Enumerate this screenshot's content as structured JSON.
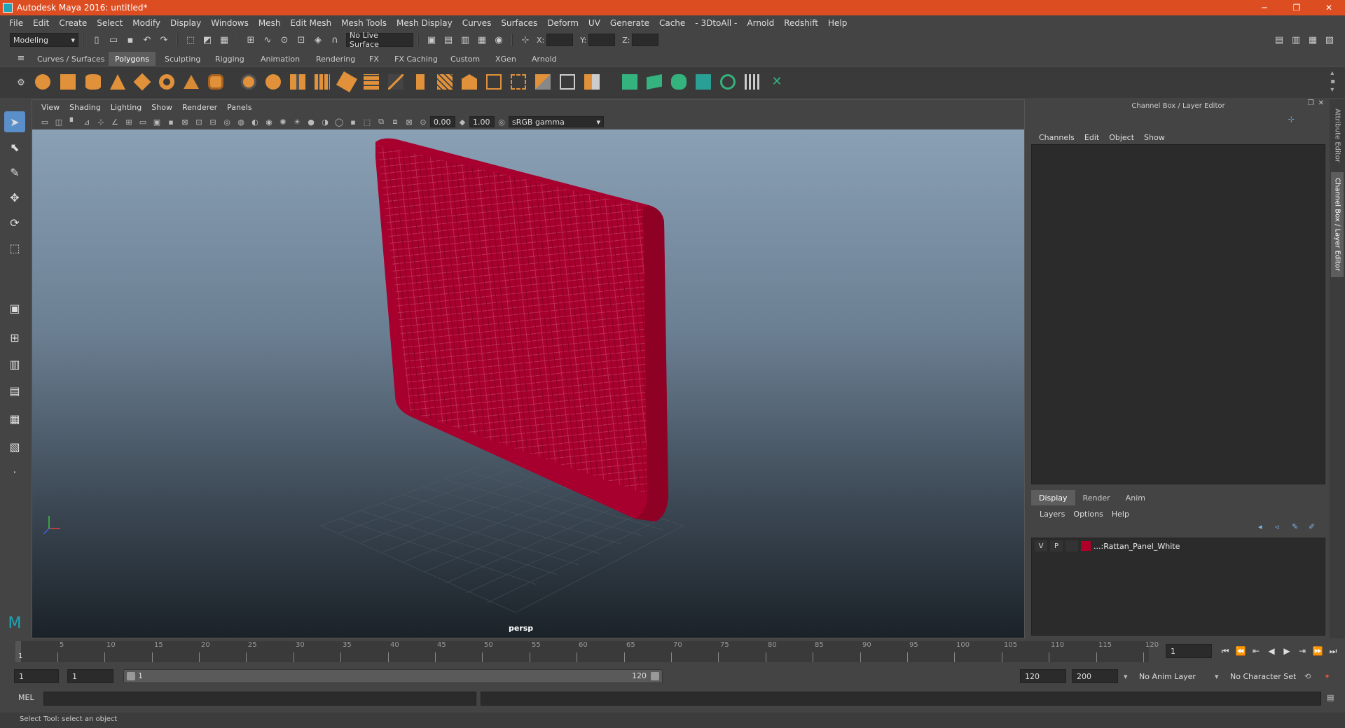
{
  "window": {
    "title": "Autodesk Maya 2016: untitled*",
    "controls": [
      "─",
      "❐",
      "✕"
    ]
  },
  "menubar": [
    "File",
    "Edit",
    "Create",
    "Select",
    "Modify",
    "Display",
    "Windows",
    "Mesh",
    "Edit Mesh",
    "Mesh Tools",
    "Mesh Display",
    "Curves",
    "Surfaces",
    "Deform",
    "UV",
    "Generate",
    "Cache",
    "- 3DtoAll -",
    "Arnold",
    "Redshift",
    "Help"
  ],
  "statusline": {
    "mode": "Modeling",
    "live_surface": "No Live Surface",
    "x_label": "X:",
    "y_label": "Y:",
    "z_label": "Z:"
  },
  "shelf_tabs": [
    {
      "label": "Curves / Surfaces",
      "active": false
    },
    {
      "label": "Polygons",
      "active": true
    },
    {
      "label": "Sculpting",
      "active": false
    },
    {
      "label": "Rigging",
      "active": false
    },
    {
      "label": "Animation",
      "active": false
    },
    {
      "label": "Rendering",
      "active": false
    },
    {
      "label": "FX",
      "active": false
    },
    {
      "label": "FX Caching",
      "active": false
    },
    {
      "label": "Custom",
      "active": false
    },
    {
      "label": "XGen",
      "active": false
    },
    {
      "label": "Arnold",
      "active": false
    }
  ],
  "viewport": {
    "menu": [
      "View",
      "Shading",
      "Lighting",
      "Show",
      "Renderer",
      "Panels"
    ],
    "exposure": "0.00",
    "gamma": "1.00",
    "color_space": "sRGB gamma",
    "camera": "persp"
  },
  "channel_box": {
    "header": "Channel Box / Layer Editor",
    "menu": [
      "Channels",
      "Edit",
      "Object",
      "Show"
    ]
  },
  "layer_editor": {
    "tabs": [
      {
        "label": "Display",
        "active": true
      },
      {
        "label": "Render",
        "active": false
      },
      {
        "label": "Anim",
        "active": false
      }
    ],
    "menu": [
      "Layers",
      "Options",
      "Help"
    ],
    "layers": [
      {
        "v": "V",
        "p": "P",
        "color": "#b0002a",
        "name": "...:Rattan_Panel_White"
      }
    ]
  },
  "side_tabs": [
    "Attribute Editor",
    "Channel Box / Layer Editor"
  ],
  "timeslider": {
    "ticks": [
      5,
      10,
      15,
      20,
      25,
      30,
      35,
      40,
      45,
      50,
      55,
      60,
      65,
      70,
      75,
      80,
      85,
      90,
      95,
      100,
      105,
      110,
      115,
      120
    ],
    "start_label": "1",
    "current_frame": "1"
  },
  "range": {
    "start": "1",
    "playback_start": "1",
    "slider_start": "1",
    "slider_end": "120",
    "playback_end": "120",
    "end": "200",
    "anim_layer": "No Anim Layer",
    "character_set": "No Character Set"
  },
  "cmdline": {
    "label": "MEL"
  },
  "helpline": {
    "text": "Select Tool: select an object"
  },
  "colors": {
    "accent": "#dd4d22",
    "mesh": "#a8002e",
    "active_tool": "#5b8fc9"
  }
}
